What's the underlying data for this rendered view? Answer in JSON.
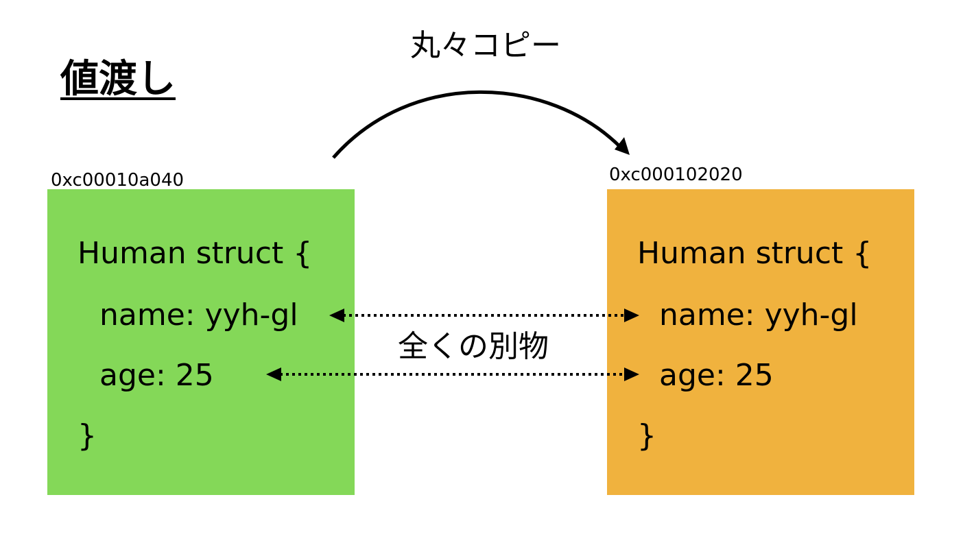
{
  "title": "値渡し",
  "copy_label": "丸々コピー",
  "difference_label": "全くの別物",
  "left_box": {
    "address": "0xc00010a040",
    "color": "#84d858",
    "lines": [
      "Human struct {",
      "name: yyh-gl",
      "age: 25",
      "}"
    ]
  },
  "right_box": {
    "address": "0xc000102020",
    "color": "#f0b23e",
    "lines": [
      "Human struct {",
      "name: yyh-gl",
      "age: 25",
      "}"
    ]
  }
}
